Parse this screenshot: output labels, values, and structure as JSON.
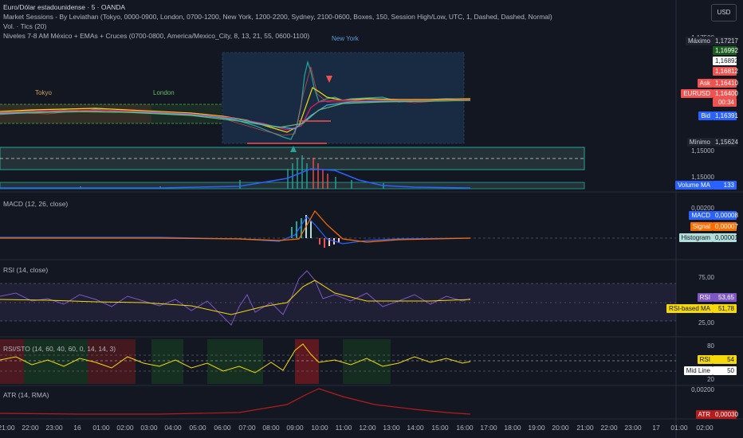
{
  "header": {
    "title": "Euro/Dólar estadounidense · 5 · OANDA",
    "currency_button": "USD",
    "indicators": [
      "Market Sessions - By Leviathan (Tokyo, 0000-0900, London, 0700-1200, New York, 1200-2200, Sydney, 2100-0600, Boxes, 150, Session High/Low, UTC, 1, Dashed, Dashed, Normal)",
      "Vol. · Tics (20)",
      "Niveles 7-8 AM México + EMAs + Cruces (0700-0800, America/Mexico_City, 8, 13, 21, 55, 0600-1100)"
    ]
  },
  "sessions": {
    "tokyo": "Tokyo",
    "london": "London",
    "new_york": "New York"
  },
  "price_axis": {
    "ticks": [
      "1,17500",
      "1,15000",
      "1,15000"
    ],
    "maximo_label": "Máximo",
    "maximo_value": "1,17217",
    "v1": "1,16992",
    "v2": "1,16892",
    "v3": "1,16812",
    "ask_label": "Ask",
    "ask_value": "1,16410",
    "symbol_label": "EURUSD",
    "symbol_value": "1,16400",
    "countdown": "00:34",
    "bid_label": "Bid",
    "bid_value": "1,16391",
    "minimo_label": "Mínimo",
    "minimo_value": "1,15624",
    "volume_ma_label": "Volume MA",
    "volume_ma_value": "133"
  },
  "macd": {
    "title": "MACD (12, 26, close)",
    "tick": "0,00200",
    "macd_label": "MACD",
    "macd_value": "0,00008",
    "signal_label": "Signal",
    "signal_value": "0,00007",
    "histogram_label": "Histogram",
    "histogram_value": "0,00001"
  },
  "rsi": {
    "title": "RSI (14, close)",
    "tick_high": "75,00",
    "tick_low": "25,00",
    "rsi_label": "RSI",
    "rsi_value": "53,65",
    "ma_label": "RSI-based MA",
    "ma_value": "51,78"
  },
  "rsi_sto": {
    "title": "RSI/STO (14, 60, 40, 60, 0, 14, 14, 3)",
    "tick_high": "80",
    "tick_low": "20",
    "rsi_label": "RSI",
    "rsi_value": "54",
    "mid_label": "Mid Line",
    "mid_value": "50"
  },
  "atr": {
    "title": "ATR (14, RMA)",
    "tick": "0,00200",
    "atr_label": "ATR",
    "atr_value": "0,00030"
  },
  "time_axis": [
    "21:00",
    "22:00",
    "23:00",
    "16",
    "01:00",
    "02:00",
    "03:00",
    "04:00",
    "05:00",
    "06:00",
    "07:00",
    "08:00",
    "09:00",
    "10:00",
    "11:00",
    "12:00",
    "13:00",
    "14:00",
    "15:00",
    "16:00",
    "17:00",
    "18:00",
    "19:00",
    "20:00",
    "21:00",
    "22:00",
    "23:00",
    "17",
    "01:00",
    "02:00"
  ],
  "colors": {
    "background": "#131722",
    "up": "#26a69a",
    "down": "#ef5350",
    "accent": "#2962ff"
  }
}
